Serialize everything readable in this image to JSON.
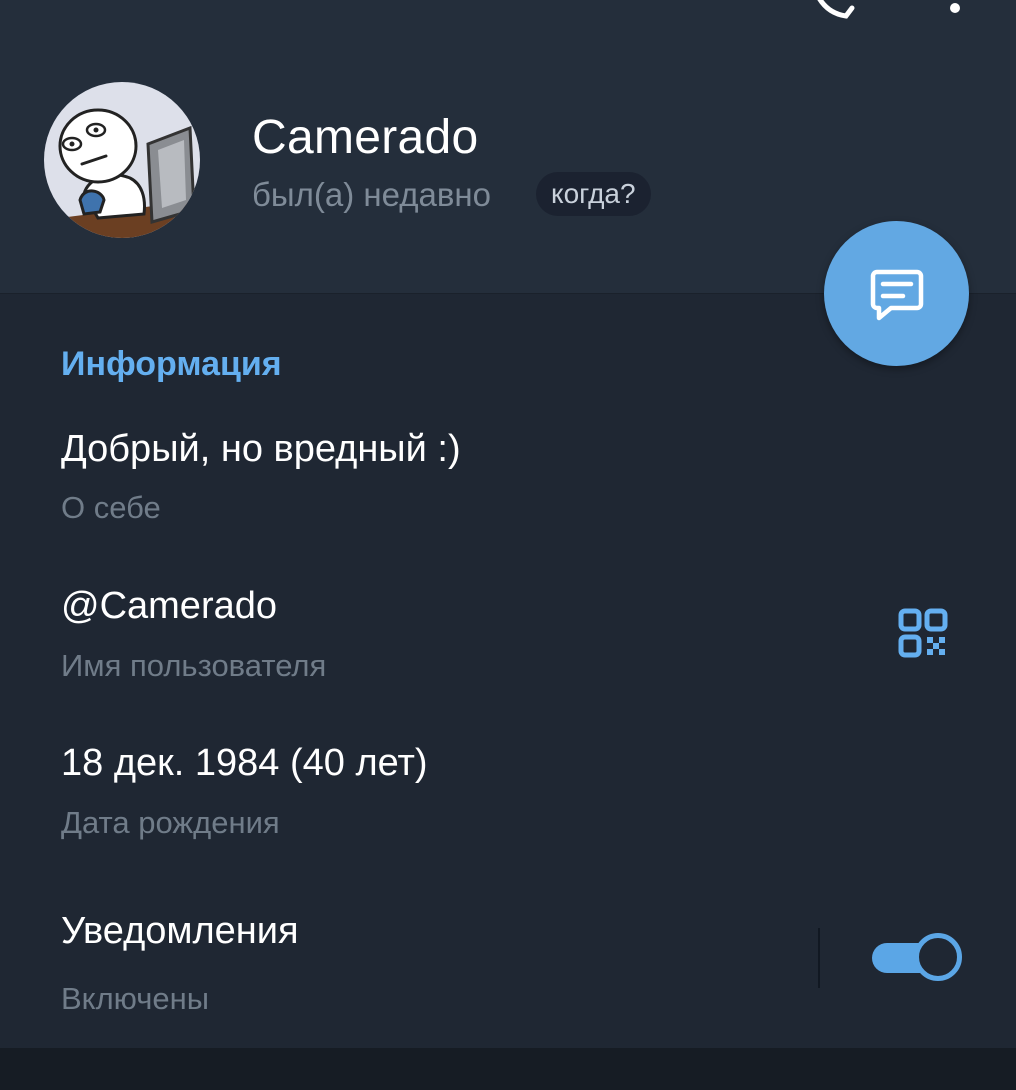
{
  "profile": {
    "name": "Camerado",
    "status": "был(а) недавно",
    "when_label": "когда?"
  },
  "info": {
    "section_title": "Информация",
    "bio": "Добрый, но вредный :)",
    "bio_label": "О себе",
    "username": "@Camerado",
    "username_label": "Имя пользователя",
    "birthday": "18 дек. 1984 (40 лет)",
    "birthday_label": "Дата рождения",
    "notifications": "Уведомления",
    "notifications_status": "Включены",
    "notifications_on": true
  },
  "icons": {
    "back": "back-arrow-icon",
    "call": "phone-icon",
    "more": "more-vertical-icon",
    "message": "message-icon",
    "qr": "qr-code-icon"
  },
  "colors": {
    "accent": "#64aff0",
    "background": "#1f2733",
    "header": "#242e3b",
    "secondary_text": "#707c89",
    "fab": "#62a8e3"
  }
}
